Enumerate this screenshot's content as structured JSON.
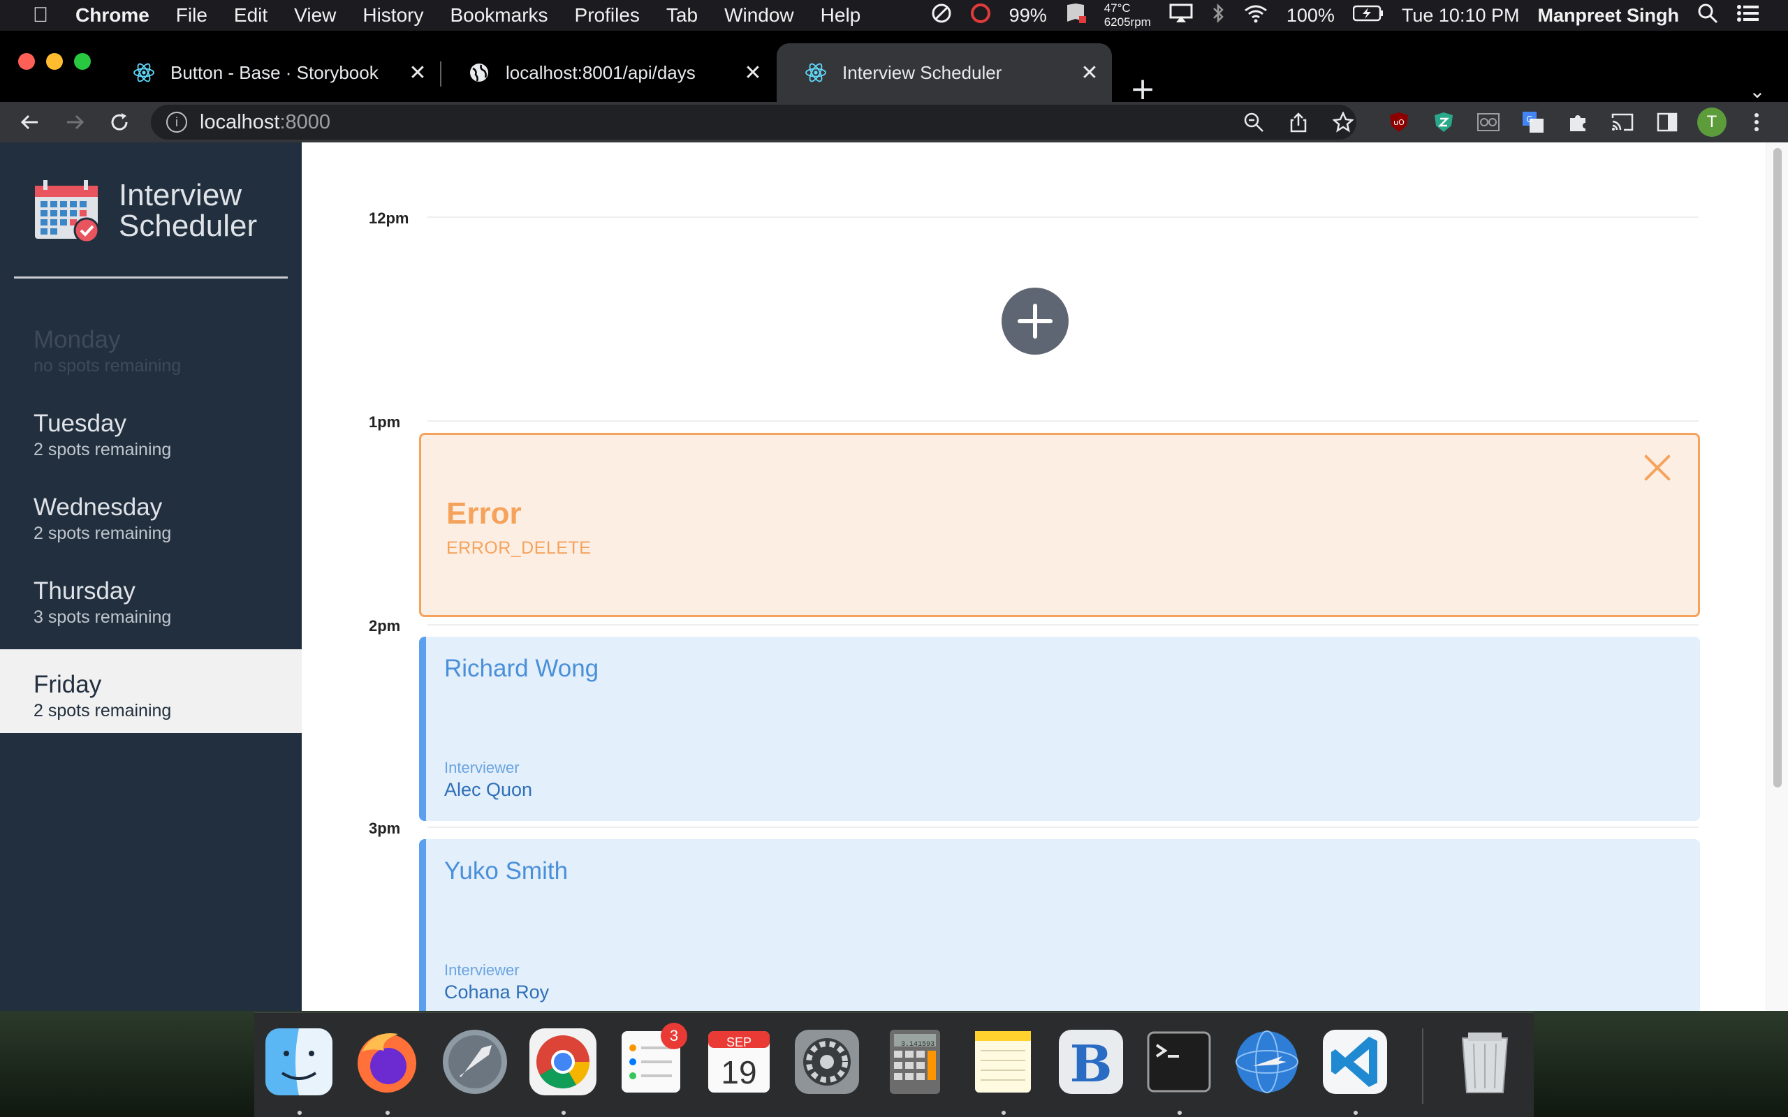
{
  "menubar": {
    "items": [
      "Chrome",
      "File",
      "Edit",
      "View",
      "History",
      "Bookmarks",
      "Profiles",
      "Tab",
      "Window",
      "Help"
    ],
    "status": {
      "cpu": "99%",
      "temp": "47°C",
      "rpm": "6205rpm",
      "battery": "100%",
      "clock": "Tue 10:10 PM",
      "user": "Manpreet Singh"
    }
  },
  "browser": {
    "tabs": [
      {
        "label": "Button - Base · Storybook",
        "icon": "react-icon"
      },
      {
        "label": "localhost:8001/api/days",
        "icon": "globe-icon"
      },
      {
        "label": "Interview Scheduler",
        "icon": "react-icon",
        "active": true
      }
    ],
    "address": {
      "host": "localhost",
      "port": ":8000"
    },
    "profile_initial": "T"
  },
  "app": {
    "title_line1": "Interview",
    "title_line2": "Scheduler",
    "days": [
      {
        "name": "Monday",
        "spots": "no spots remaining",
        "state": "full"
      },
      {
        "name": "Tuesday",
        "spots": "2 spots remaining",
        "state": "normal"
      },
      {
        "name": "Wednesday",
        "spots": "2 spots remaining",
        "state": "normal"
      },
      {
        "name": "Thursday",
        "spots": "3 spots remaining",
        "state": "normal"
      },
      {
        "name": "Friday",
        "spots": "2 spots remaining",
        "state": "selected"
      }
    ],
    "hours": [
      "12pm",
      "1pm",
      "2pm",
      "3pm"
    ],
    "error": {
      "title": "Error",
      "message": "ERROR_DELETE"
    },
    "appointments": [
      {
        "student": "Richard Wong",
        "interviewer_label": "Interviewer",
        "interviewer": "Alec Quon"
      },
      {
        "student": "Yuko Smith",
        "interviewer_label": "Interviewer",
        "interviewer": "Cohana Roy"
      }
    ]
  },
  "dock": {
    "calendar_month": "SEP",
    "calendar_day": "19",
    "reminders_badge": "3",
    "calculator_display": "3.141593",
    "apps": [
      "finder-icon",
      "firefox-icon",
      "launchpad-icon",
      "chrome-icon",
      "reminders-icon",
      "calendar-icon",
      "system-preferences-icon",
      "calculator-icon",
      "notes-icon",
      "bbedit-icon",
      "terminal-icon",
      "network-icon",
      "vscode-icon",
      "trash-icon"
    ]
  },
  "colors": {
    "sidebar": "#222f3e",
    "error_accent": "#f5a35c",
    "appointment_bg": "#e3effb",
    "appointment_accent": "#5aa0ef"
  }
}
